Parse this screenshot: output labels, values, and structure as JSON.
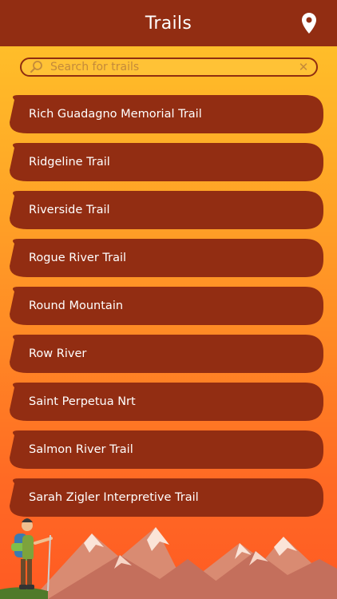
{
  "header": {
    "title": "Trails",
    "location_icon": "map-pin-icon"
  },
  "search": {
    "placeholder": "Search for trails",
    "value": "",
    "search_icon": "magnifier-icon",
    "clear_icon": "close-icon"
  },
  "trails": [
    {
      "label": "Rich Guadagno Memorial Trail"
    },
    {
      "label": "Ridgeline Trail"
    },
    {
      "label": "Riverside Trail"
    },
    {
      "label": "Rogue River Trail"
    },
    {
      "label": "Round Mountain"
    },
    {
      "label": "Row River"
    },
    {
      "label": "Saint Perpetua Nrt"
    },
    {
      "label": "Salmon River Trail"
    },
    {
      "label": "Sarah Zigler Interpretive Trail"
    }
  ],
  "colors": {
    "header_bg": "#922d12",
    "item_bg": "#922d12",
    "gradient_top": "#ffc52a",
    "gradient_bottom": "#ff5a23"
  }
}
